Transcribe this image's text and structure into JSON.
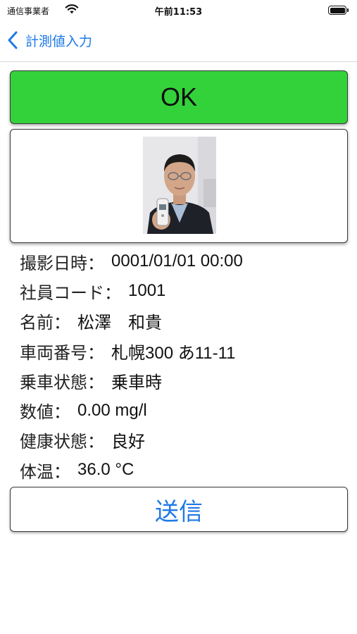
{
  "status_bar": {
    "carrier": "通信事業者",
    "time": "午前11:53",
    "icons": [
      "wifi-icon",
      "battery-icon"
    ]
  },
  "nav": {
    "back_label": "計測値入力",
    "back_icon": "chevron-left-icon"
  },
  "result": {
    "label": "OK",
    "color": "#33d23b"
  },
  "details": [
    {
      "label": "撮影日時：",
      "value": "0001/01/01 00:00"
    },
    {
      "label": "社員コード：",
      "value": "1001"
    },
    {
      "label": "名前：",
      "value": "松澤　和貴"
    },
    {
      "label": "車両番号：",
      "value": "札幌300 あ11-11"
    },
    {
      "label": "乗車状態：",
      "value": "乗車時"
    },
    {
      "label": "数値：",
      "value": "0.00 mg/l"
    },
    {
      "label": "健康状態：",
      "value": "良好"
    },
    {
      "label": "体温：",
      "value": "36.0 °C"
    }
  ],
  "send_button": {
    "label": "送信"
  },
  "colors": {
    "accent": "#1e7ae6",
    "ok_green": "#33d23b"
  }
}
